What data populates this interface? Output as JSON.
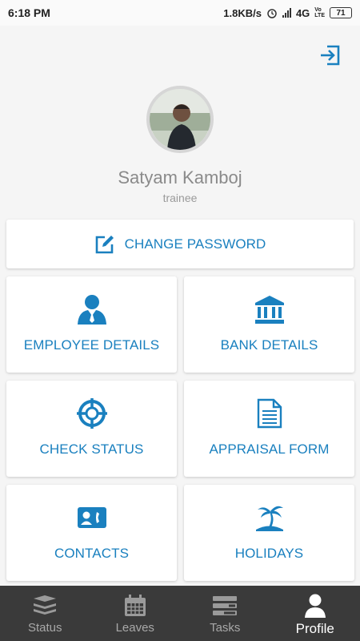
{
  "status_bar": {
    "time": "6:18 PM",
    "speed": "1.8KB/s",
    "network": "4G",
    "volte_top": "Vo",
    "volte_bottom": "LTE",
    "battery": "71"
  },
  "profile": {
    "name": "Satyam Kamboj",
    "role": "trainee"
  },
  "actions": {
    "change_password": "CHANGE PASSWORD",
    "employee_details": "EMPLOYEE DETAILS",
    "bank_details": "BANK DETAILS",
    "check_status": "CHECK STATUS",
    "appraisal_form": "APPRAISAL FORM",
    "contacts": "CONTACTS",
    "holidays": "HOLIDAYS"
  },
  "nav": [
    {
      "label": "Status",
      "icon": "stack-icon"
    },
    {
      "label": "Leaves",
      "icon": "calendar-icon"
    },
    {
      "label": "Tasks",
      "icon": "tasks-icon"
    },
    {
      "label": "Profile",
      "icon": "profile-icon"
    }
  ],
  "active_nav": "Profile",
  "colors": {
    "accent": "#1a80bf",
    "nav_bg": "#3a3a3a",
    "nav_active": "#ffffff",
    "nav_inactive": "#a8a8a8"
  }
}
